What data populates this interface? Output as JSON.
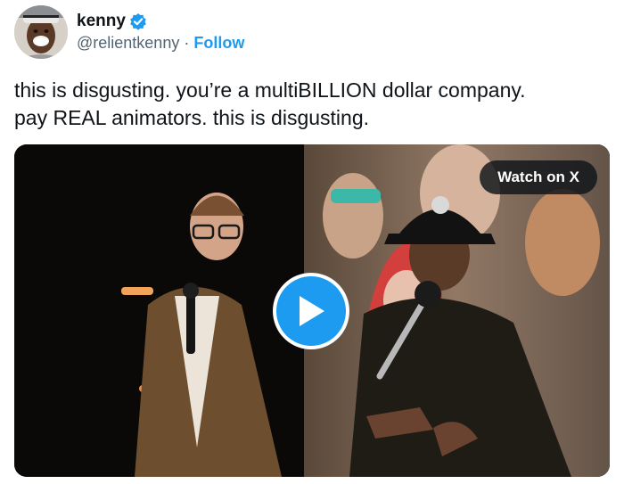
{
  "tweet": {
    "author": {
      "display_name": "kenny",
      "handle": "@relientkenny",
      "verified": true,
      "avatar_icon": "person-avatar"
    },
    "separator": "·",
    "follow_label": "Follow",
    "text": "this is disgusting. you’re a multiBILLION dollar company.\npay REAL animators. this is disgusting.",
    "media": {
      "type": "video",
      "watch_label": "Watch on X",
      "play_icon": "play-icon"
    }
  },
  "colors": {
    "accent": "#1d9bf0",
    "text": "#0f1419",
    "muted": "#536471"
  }
}
